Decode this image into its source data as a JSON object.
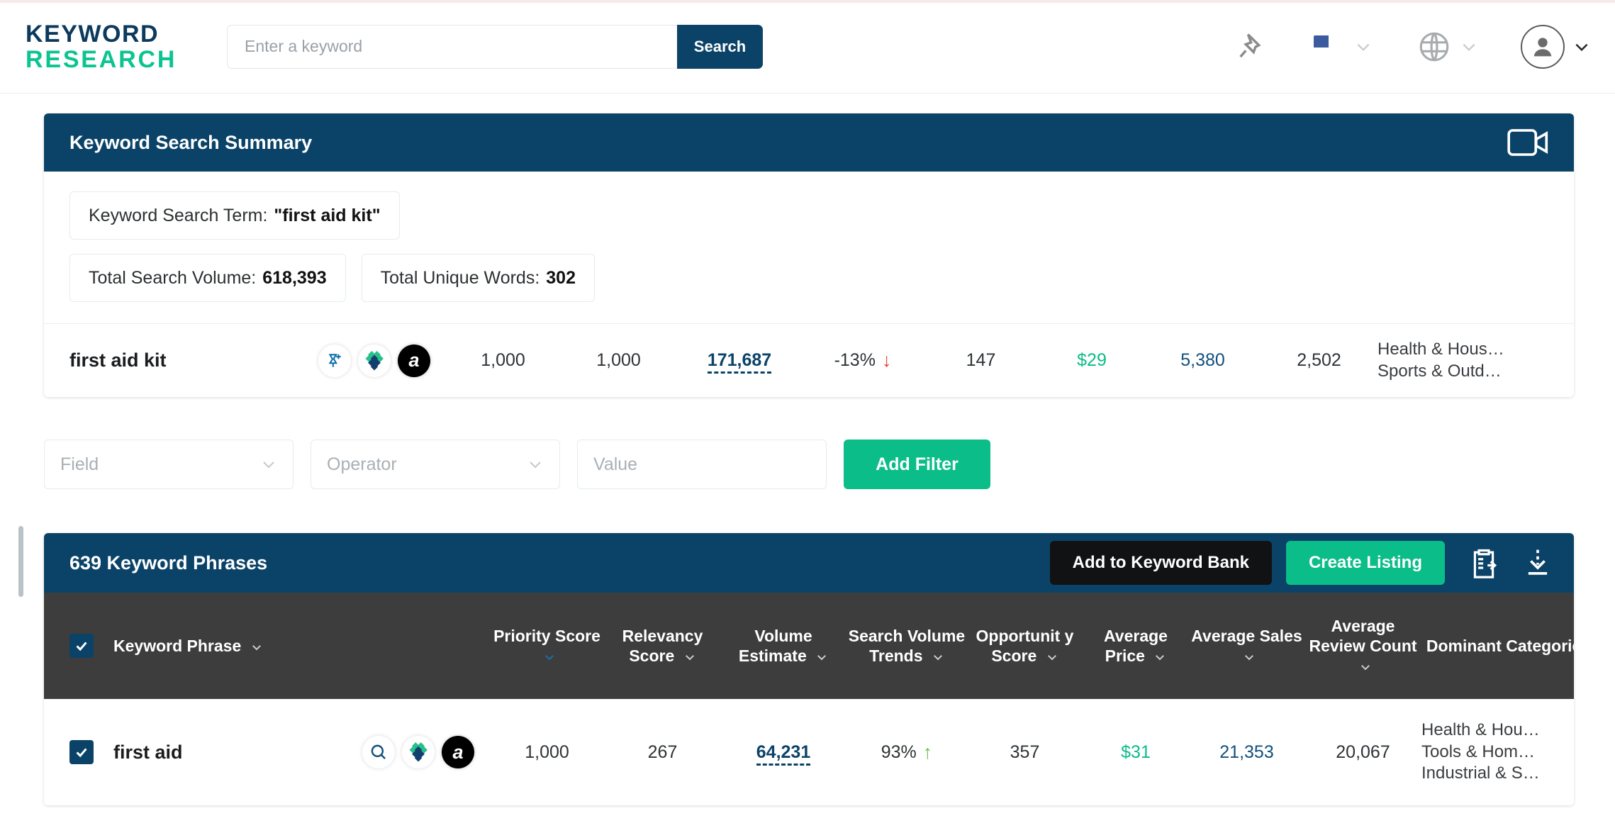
{
  "header": {
    "logo_line1": "KEYWORD",
    "logo_line2": "RESEARCH",
    "search_placeholder": "Enter a keyword",
    "search_value": "",
    "search_button": "Search",
    "pin_icon": "pin-icon",
    "flag_icon": "us-flag-icon",
    "globe_icon": "globe-icon",
    "avatar_icon": "avatar-icon"
  },
  "summary": {
    "title": "Keyword Search Summary",
    "video_icon": "video-icon",
    "search_term_label": "Keyword Search Term:",
    "search_term_value": "\"first aid kit\"",
    "total_volume_label": "Total Search Volume:",
    "total_volume_value": "618,393",
    "unique_words_label": "Total Unique Words:",
    "unique_words_value": "302",
    "row": {
      "keyword": "first aid kit",
      "icons": [
        "add-to-list-icon",
        "helium-diamond-icon",
        "amazon-icon"
      ],
      "priority_score": "1,000",
      "relevancy_score": "1,000",
      "volume_estimate": "171,687",
      "search_volume_trend": "-13%",
      "trend_direction": "down",
      "opportunity_score": "147",
      "average_price": "$29",
      "average_sales": "5,380",
      "average_review_count": "2,502",
      "dominant_categories": [
        "Health & Hous…",
        "Sports & Outd…"
      ]
    }
  },
  "filters": {
    "field_placeholder": "Field",
    "operator_placeholder": "Operator",
    "value_placeholder": "Value",
    "add_filter_label": "Add Filter"
  },
  "phrases": {
    "title": "639 Keyword Phrases",
    "add_to_bank_label": "Add to Keyword Bank",
    "create_listing_label": "Create Listing",
    "clipboard_icon": "clipboard-import-icon",
    "download_icon": "download-icon",
    "columns": [
      {
        "label": "Keyword Phrase",
        "sortable": true,
        "sorted": false
      },
      {
        "label": "Priority Score",
        "sortable": true,
        "sorted": true
      },
      {
        "label": "Relevancy Score",
        "sortable": true,
        "sorted": false
      },
      {
        "label": "Volume Estimate",
        "sortable": true,
        "sorted": false
      },
      {
        "label": "Search Volume Trends",
        "sortable": true,
        "sorted": false
      },
      {
        "label": "Opportunit y Score",
        "sortable": true,
        "sorted": false
      },
      {
        "label": "Average Price",
        "sortable": true,
        "sorted": false
      },
      {
        "label": "Average Sales",
        "sortable": true,
        "sorted": false
      },
      {
        "label": "Average Review Count",
        "sortable": true,
        "sorted": false
      },
      {
        "label": "Dominant Categories",
        "sortable": false,
        "sorted": false
      }
    ],
    "rows": [
      {
        "checked": true,
        "keyword": "first aid",
        "icons": [
          "search-magnifier-icon",
          "helium-diamond-icon",
          "amazon-icon"
        ],
        "priority_score": "1,000",
        "relevancy_score": "267",
        "volume_estimate": "64,231",
        "search_volume_trend": "93%",
        "trend_direction": "up",
        "opportunity_score": "357",
        "average_price": "$31",
        "average_sales": "21,353",
        "average_review_count": "20,067",
        "dominant_categories": [
          "Health & Hou…",
          "Tools & Hom…",
          "Industrial & S…"
        ]
      }
    ]
  },
  "colors": {
    "navy": "#0b4368",
    "green": "#0bbd88",
    "header_gray": "#3d3d3d",
    "trend_down": "#ef3e36",
    "trend_up": "#6cc04a"
  }
}
